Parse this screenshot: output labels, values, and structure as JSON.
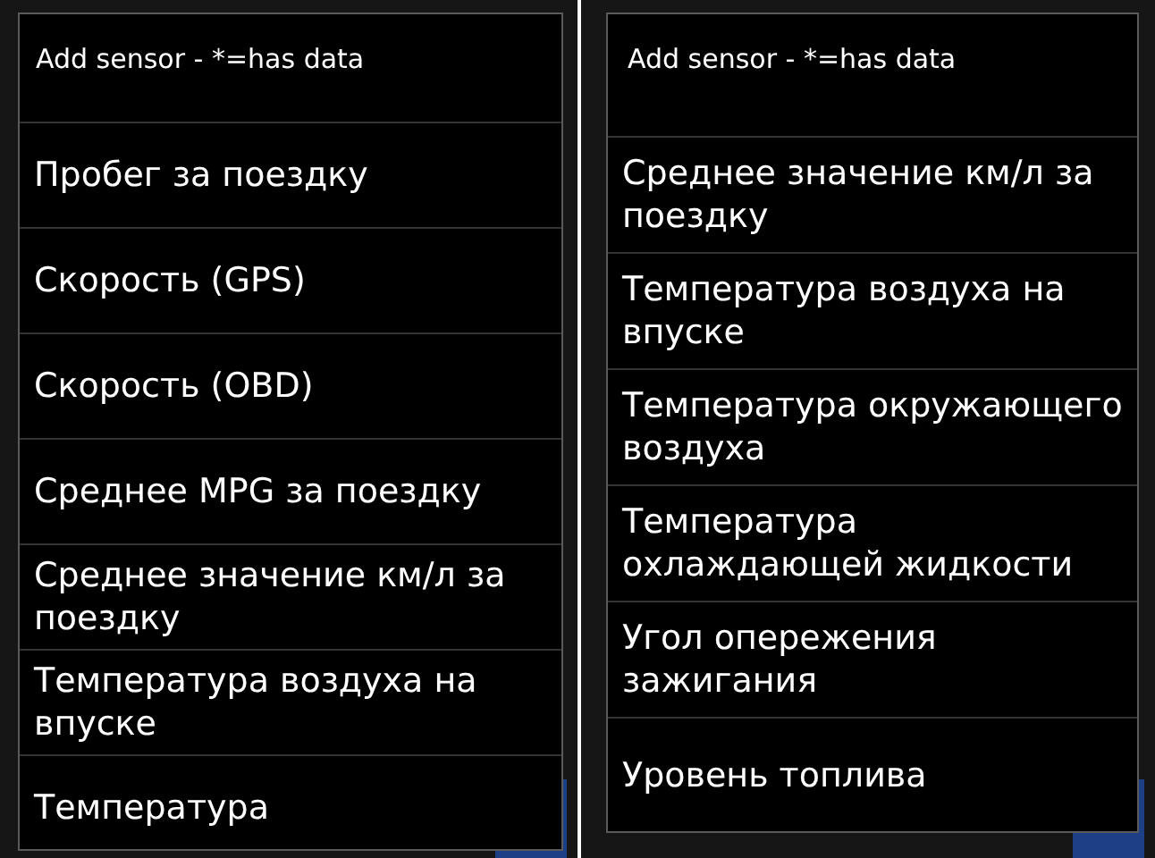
{
  "dialogs": [
    {
      "title": "Add sensor - *=has data",
      "items": [
        {
          "label": "Пробег за поездку"
        },
        {
          "label": "Скорость (GPS)"
        },
        {
          "label": "Скорость (OBD)"
        },
        {
          "label": "Среднее MPG за поездку"
        },
        {
          "label": "Среднее значение км/л за поездку"
        },
        {
          "label": "Температура воздуха на впуске"
        },
        {
          "label": "Температура"
        }
      ]
    },
    {
      "title": "Add sensor - *=has data",
      "items": [
        {
          "label": "Среднее значение км/л за поездку"
        },
        {
          "label": "Температура воздуха на впуске"
        },
        {
          "label": "Температура окружающего воздуха"
        },
        {
          "label": "Температура охлаждающей жидкости"
        },
        {
          "label": "Угол опережения зажигания"
        },
        {
          "label": "Уровень топлива"
        }
      ]
    }
  ]
}
